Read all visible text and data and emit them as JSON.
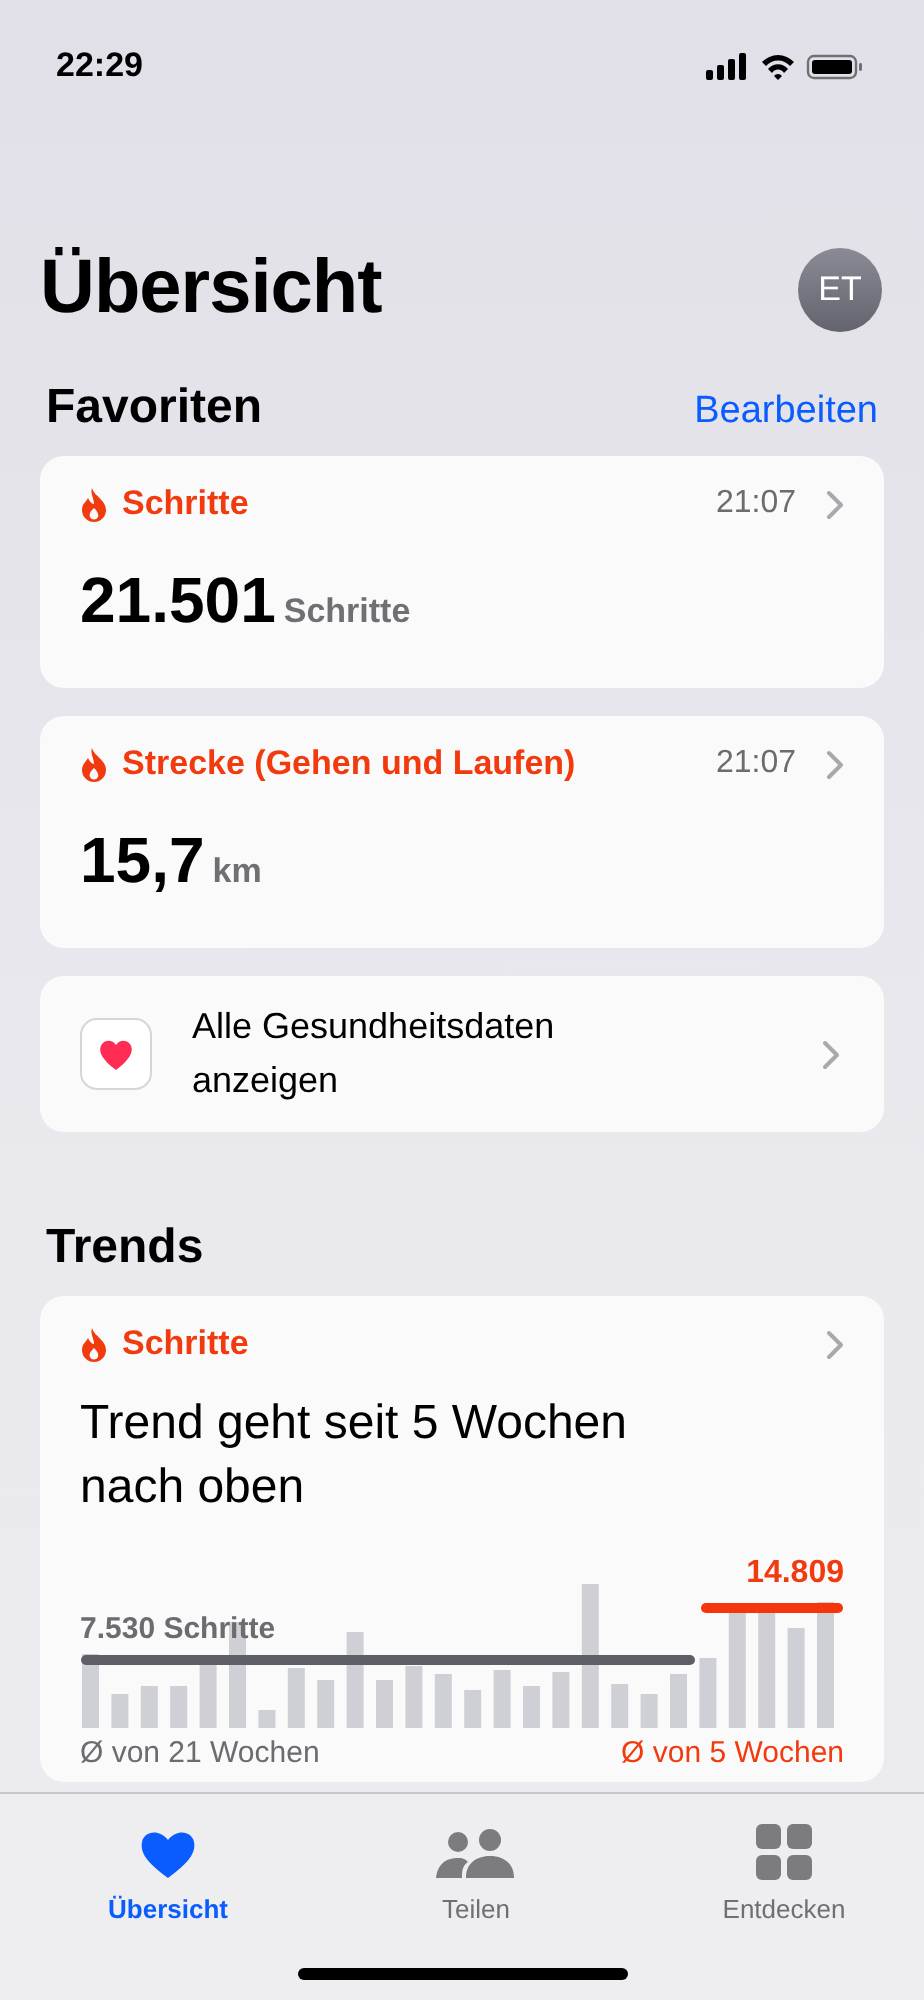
{
  "status_bar": {
    "time": "22:29"
  },
  "header": {
    "title": "Übersicht",
    "avatar": "ET"
  },
  "favorites": {
    "title": "Favoriten",
    "action": "Bearbeiten",
    "cards": [
      {
        "kind": "metric",
        "label": "Schritte",
        "time": "21:07",
        "value": "21.501",
        "unit": "Schritte"
      },
      {
        "kind": "metric",
        "label": "Strecke (Gehen und Laufen)",
        "time": "21:07",
        "value": "15,7",
        "unit": "km"
      },
      {
        "kind": "link",
        "label": "Alle Gesundheitsdaten anzeigen"
      }
    ]
  },
  "trends": {
    "title": "Trends",
    "card": {
      "label": "Schritte",
      "headline": "Trend geht seit 5 Wochen nach oben",
      "baseline_value": "7.530 Schritte",
      "recent_value": "14.809",
      "baseline_caption": "Ø von 21 Wochen",
      "recent_caption": "Ø von 5 Wochen"
    }
  },
  "tab_bar": [
    {
      "label": "Übersicht",
      "selected": true
    },
    {
      "label": "Teilen",
      "selected": false
    },
    {
      "label": "Entdecken",
      "selected": false
    }
  ]
}
